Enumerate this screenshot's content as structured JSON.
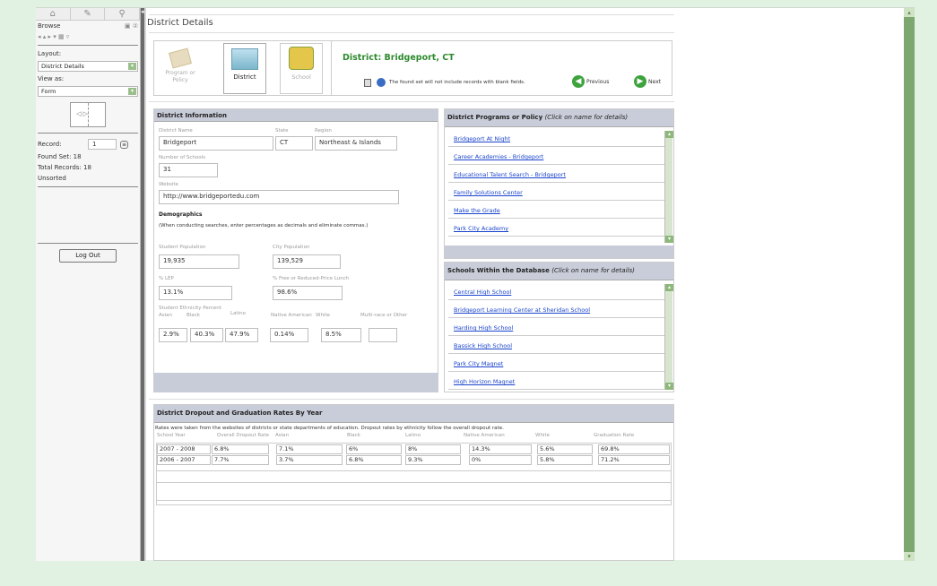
{
  "sidebar": {
    "browse": "Browse",
    "layout_label": "Layout:",
    "layout_value": "District Details",
    "view_as_label": "View as:",
    "view_value": "Form",
    "record_label": "Record:",
    "record_value": "1",
    "found_set": "Found Set: 18",
    "total_records": "Total Records: 18",
    "sort_status": "Unsorted",
    "logout_label": "Log Out",
    "record_menu_icon": "menu-icon"
  },
  "page": {
    "title": "District Details"
  },
  "nav": {
    "tab1": "Program or\nPolicy",
    "tab2": "District",
    "tab3": "School",
    "heading": "District: Bridgeport, CT",
    "note": "The found set will not include records with blank fields.",
    "previous": "Previous",
    "next": "Next"
  },
  "info": {
    "header": "District Information",
    "district_name_label": "District Name",
    "state_label": "State",
    "region_label": "Region",
    "district_name": "Bridgeport",
    "state": "CT",
    "region": "Northeast & Islands",
    "num_schools_label": "Number of Schools",
    "num_schools": "31",
    "website_label": "Website",
    "website": "http://www.bridgeportedu.com",
    "demographics": "Demographics",
    "demographics_note": "(When conducting searches, enter percentages as decimals and eliminate commas.)",
    "student_pop_label": "Student Population",
    "city_pop_label": "City Population",
    "student_pop": "19,935",
    "city_pop": "139,529",
    "lep_label": "% LEP",
    "lunch_label": "% Free or Reduced-Price Lunch",
    "lep": "13.1%",
    "lunch": "98.6%",
    "ethnicity_label": "Student Ethnicity Percent",
    "eth_labels": [
      "Asian",
      "Black",
      "Latino",
      "Native American",
      "White",
      "Multi-race or Other"
    ],
    "eth_values": [
      "2.9%",
      "40.3%",
      "47.9%",
      "0.14%",
      "8.5%",
      ""
    ]
  },
  "programs": {
    "header": "District Programs or Policy",
    "hint": "(Click on name for details)",
    "items": [
      "Bridgeport At Night",
      "Career Academies - Bridgeport",
      "Educational Talent Search - Bridgeport",
      "Family Solutions Center",
      "Make the Grade",
      "Park City Academy"
    ]
  },
  "schools": {
    "header": "Schools Within the Database",
    "hint": "(Click on name for details)",
    "items": [
      "Central High School",
      "Bridgeport Learning Center at Sheridan School",
      "Harding High School",
      "Bassick High School",
      "Park City Magnet",
      "High Horizon Magnet"
    ]
  },
  "rates": {
    "header": "District Dropout and Graduation Rates By Year",
    "note": "Rates were taken from the websites of districts or state departments of education. Dropout rates by ethnicity follow the overall dropout rate.",
    "columns": [
      "School Year",
      "Overall Dropout Rate",
      "Asian",
      "Black",
      "Latino",
      "Native American",
      "White",
      "Graduation Rate"
    ],
    "rows": [
      [
        "2007 - 2008",
        "6.8%",
        "7.1%",
        "6%",
        "8%",
        "14.3%",
        "5.6%",
        "69.8%"
      ],
      [
        "2006 - 2007",
        "7.7%",
        "3.7%",
        "6.8%",
        "9.3%",
        "0%",
        "5.8%",
        "71.2%"
      ]
    ]
  }
}
